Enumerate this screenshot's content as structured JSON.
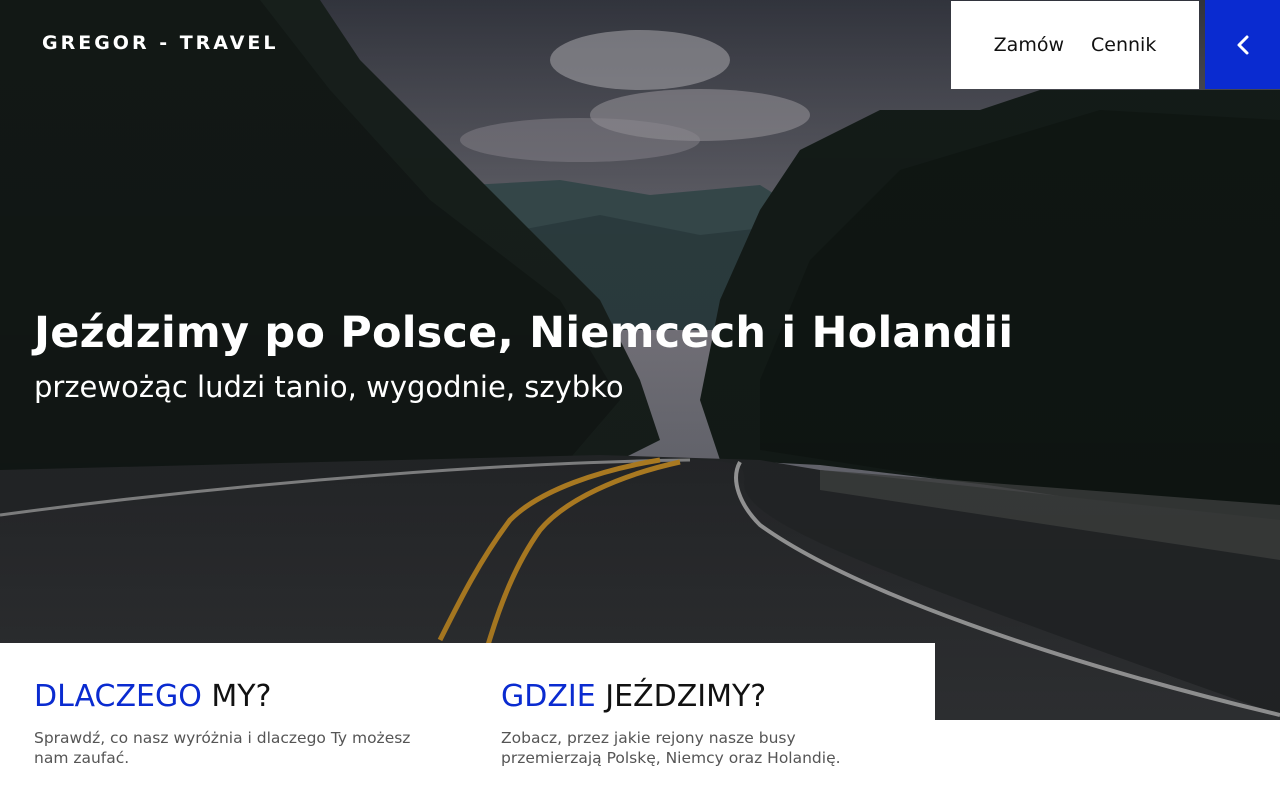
{
  "header": {
    "brand": "GREGOR - TRAVEL",
    "nav": [
      {
        "label": "Zamów"
      },
      {
        "label": "Cennik"
      }
    ],
    "menu_toggle_icon": "chevron-left-icon"
  },
  "hero": {
    "title": "Jeździmy po Polsce, Niemcech i Holandii",
    "subtitle": "przewożąc ludzi tanio, wygodnie, szybko"
  },
  "info": [
    {
      "title_accent": "DLACZEGO",
      "title_rest": " MY?",
      "description": "Sprawdź, co nasz wyróżnia i dlaczego Ty możesz nam zaufać."
    },
    {
      "title_accent": "GDZIE",
      "title_rest": " JEŹDZIMY?",
      "description": "Zobacz, przez jakie rejony nasze busy przemierzają Polskę, Niemcy oraz Holandię."
    }
  ],
  "colors": {
    "accent": "#0a2bd0",
    "text_dark": "#111111",
    "text_muted": "#555555"
  }
}
